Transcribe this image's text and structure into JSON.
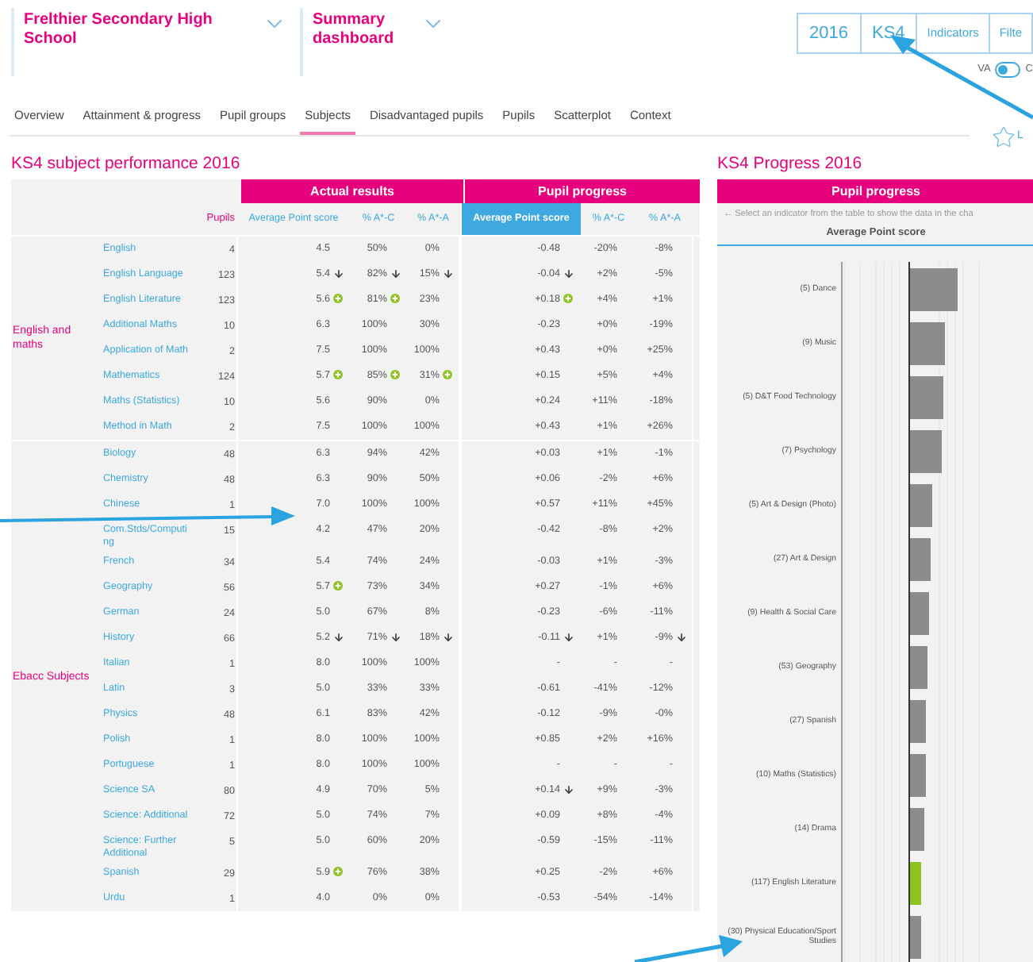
{
  "header": {
    "school": "Frelthier Secondary High School",
    "view": "Summary dashboard"
  },
  "top_buttons": [
    {
      "label": "2016",
      "kind": "value"
    },
    {
      "label": "KS4",
      "kind": "value"
    },
    {
      "label": "Indicators",
      "kind": "menu"
    },
    {
      "label": "Filte",
      "kind": "menu"
    }
  ],
  "toggle": {
    "left_label": "VA",
    "right_label": "C",
    "on": false
  },
  "tabs": [
    {
      "label": "Overview",
      "selected": false
    },
    {
      "label": "Attainment & progress",
      "selected": false
    },
    {
      "label": "Pupil groups",
      "selected": false
    },
    {
      "label": "Subjects",
      "selected": true
    },
    {
      "label": "Disadvantaged pupils",
      "selected": false
    },
    {
      "label": "Pupils",
      "selected": false
    },
    {
      "label": "Scatterplot",
      "selected": false
    },
    {
      "label": "Context",
      "selected": false
    }
  ],
  "favourite": {
    "label": "L"
  },
  "left_title": "KS4 subject performance 2016",
  "table": {
    "group_headers": [
      "Actual results",
      "Pupil progress"
    ],
    "pupils_label": "Pupils",
    "columns": [
      {
        "label": "Average Point score",
        "selected": false
      },
      {
        "label": "% A*-C",
        "selected": false
      },
      {
        "label": "% A*-A",
        "selected": false
      },
      {
        "label": "Average Point score",
        "selected": true
      },
      {
        "label": "% A*-C",
        "selected": false
      },
      {
        "label": "% A*-A",
        "selected": false
      }
    ],
    "groups": [
      {
        "label": "English and maths",
        "rows": [
          {
            "subject": "English",
            "pupils": "4",
            "cells": [
              {
                "text": "4.5"
              },
              {
                "text": "50%"
              },
              {
                "text": "0%"
              },
              {
                "text": "-0.48"
              },
              {
                "text": "-20%"
              },
              {
                "text": "-8%"
              }
            ]
          },
          {
            "subject": "English Language",
            "pupils": "123",
            "cells": [
              {
                "text": "5.4",
                "falling": true
              },
              {
                "text": "82%",
                "falling": true
              },
              {
                "text": "15%",
                "falling": true
              },
              {
                "text": "-0.04",
                "falling": true
              },
              {
                "text": "+2%"
              },
              {
                "text": "-5%"
              }
            ]
          },
          {
            "subject": "English Literature",
            "pupils": "123",
            "cells": [
              {
                "text": "5.6",
                "significant": true
              },
              {
                "text": "81%",
                "significant": true
              },
              {
                "text": "23%"
              },
              {
                "text": "+0.18",
                "significant": true
              },
              {
                "text": "+4%"
              },
              {
                "text": "+1%"
              }
            ]
          },
          {
            "subject": "Additional Maths",
            "pupils": "10",
            "cells": [
              {
                "text": "6.3"
              },
              {
                "text": "100%"
              },
              {
                "text": "30%"
              },
              {
                "text": "-0.23"
              },
              {
                "text": "+0%"
              },
              {
                "text": "-19%"
              }
            ]
          },
          {
            "subject": "Application of Math",
            "pupils": "2",
            "cells": [
              {
                "text": "7.5"
              },
              {
                "text": "100%"
              },
              {
                "text": "100%"
              },
              {
                "text": "+0.43"
              },
              {
                "text": "+0%"
              },
              {
                "text": "+25%"
              }
            ]
          },
          {
            "subject": "Mathematics",
            "pupils": "124",
            "cells": [
              {
                "text": "5.7",
                "significant": true
              },
              {
                "text": "85%",
                "significant": true
              },
              {
                "text": "31%",
                "significant": true
              },
              {
                "text": "+0.15"
              },
              {
                "text": "+5%"
              },
              {
                "text": "+4%"
              }
            ]
          },
          {
            "subject": "Maths (Statistics)",
            "pupils": "10",
            "cells": [
              {
                "text": "5.6"
              },
              {
                "text": "90%"
              },
              {
                "text": "0%"
              },
              {
                "text": "+0.24"
              },
              {
                "text": "+11%"
              },
              {
                "text": "-18%"
              }
            ]
          },
          {
            "subject": "Method in Math",
            "pupils": "2",
            "cells": [
              {
                "text": "7.5"
              },
              {
                "text": "100%"
              },
              {
                "text": "100%"
              },
              {
                "text": "+0.43"
              },
              {
                "text": "+1%"
              },
              {
                "text": "+26%"
              }
            ]
          }
        ]
      },
      {
        "label": "Ebacc Subjects",
        "rows": [
          {
            "subject": "Biology",
            "pupils": "48",
            "cells": [
              {
                "text": "6.3"
              },
              {
                "text": "94%"
              },
              {
                "text": "42%"
              },
              {
                "text": "+0.03"
              },
              {
                "text": "+1%"
              },
              {
                "text": "-1%"
              }
            ]
          },
          {
            "subject": "Chemistry",
            "pupils": "48",
            "cells": [
              {
                "text": "6.3"
              },
              {
                "text": "90%"
              },
              {
                "text": "50%"
              },
              {
                "text": "+0.06"
              },
              {
                "text": "-2%"
              },
              {
                "text": "+6%"
              }
            ]
          },
          {
            "subject": "Chinese",
            "pupils": "1",
            "cells": [
              {
                "text": "7.0"
              },
              {
                "text": "100%"
              },
              {
                "text": "100%"
              },
              {
                "text": "+0.57"
              },
              {
                "text": "+11%"
              },
              {
                "text": "+45%"
              }
            ]
          },
          {
            "subject": "Com.Stds/Computing",
            "pupils": "15",
            "cells": [
              {
                "text": "4.2"
              },
              {
                "text": "47%"
              },
              {
                "text": "20%"
              },
              {
                "text": "-0.42"
              },
              {
                "text": "-8%"
              },
              {
                "text": "+2%"
              }
            ]
          },
          {
            "subject": "French",
            "pupils": "34",
            "cells": [
              {
                "text": "5.4"
              },
              {
                "text": "74%"
              },
              {
                "text": "24%"
              },
              {
                "text": "-0.03"
              },
              {
                "text": "+1%"
              },
              {
                "text": "-3%"
              }
            ]
          },
          {
            "subject": "Geography",
            "pupils": "56",
            "cells": [
              {
                "text": "5.7",
                "significant": true
              },
              {
                "text": "73%"
              },
              {
                "text": "34%"
              },
              {
                "text": "+0.27"
              },
              {
                "text": "-1%"
              },
              {
                "text": "+6%"
              }
            ]
          },
          {
            "subject": "German",
            "pupils": "24",
            "cells": [
              {
                "text": "5.0"
              },
              {
                "text": "67%"
              },
              {
                "text": "8%"
              },
              {
                "text": "-0.23"
              },
              {
                "text": "-6%"
              },
              {
                "text": "-11%"
              }
            ]
          },
          {
            "subject": "History",
            "pupils": "66",
            "cells": [
              {
                "text": "5.2",
                "falling": true
              },
              {
                "text": "71%",
                "falling": true
              },
              {
                "text": "18%",
                "falling": true
              },
              {
                "text": "-0.11",
                "falling": true
              },
              {
                "text": "+1%"
              },
              {
                "text": "-9%",
                "falling": true
              }
            ]
          },
          {
            "subject": "Italian",
            "pupils": "1",
            "cells": [
              {
                "text": "8.0"
              },
              {
                "text": "100%"
              },
              {
                "text": "100%"
              },
              {
                "text": "-"
              },
              {
                "text": "-"
              },
              {
                "text": "-"
              }
            ]
          },
          {
            "subject": "Latin",
            "pupils": "3",
            "cells": [
              {
                "text": "5.0"
              },
              {
                "text": "33%"
              },
              {
                "text": "33%"
              },
              {
                "text": "-0.61"
              },
              {
                "text": "-41%"
              },
              {
                "text": "-12%"
              }
            ]
          },
          {
            "subject": "Physics",
            "pupils": "48",
            "cells": [
              {
                "text": "6.1"
              },
              {
                "text": "83%"
              },
              {
                "text": "42%"
              },
              {
                "text": "-0.12"
              },
              {
                "text": "-9%"
              },
              {
                "text": "-0%"
              }
            ]
          },
          {
            "subject": "Polish",
            "pupils": "1",
            "cells": [
              {
                "text": "8.0"
              },
              {
                "text": "100%"
              },
              {
                "text": "100%"
              },
              {
                "text": "+0.85"
              },
              {
                "text": "+2%"
              },
              {
                "text": "+16%"
              }
            ]
          },
          {
            "subject": "Portuguese",
            "pupils": "1",
            "cells": [
              {
                "text": "8.0"
              },
              {
                "text": "100%"
              },
              {
                "text": "100%"
              },
              {
                "text": "-"
              },
              {
                "text": "-"
              },
              {
                "text": "-"
              }
            ]
          },
          {
            "subject": "Science SA",
            "pupils": "80",
            "cells": [
              {
                "text": "4.9"
              },
              {
                "text": "70%"
              },
              {
                "text": "5%"
              },
              {
                "text": "+0.14",
                "falling": true
              },
              {
                "text": "+9%"
              },
              {
                "text": "-3%"
              }
            ]
          },
          {
            "subject": "Science: Additional",
            "pupils": "72",
            "cells": [
              {
                "text": "5.0"
              },
              {
                "text": "74%"
              },
              {
                "text": "7%"
              },
              {
                "text": "+0.09"
              },
              {
                "text": "+8%"
              },
              {
                "text": "-4%"
              }
            ]
          },
          {
            "subject": "Science: Further Additional",
            "pupils": "5",
            "cells": [
              {
                "text": "5.0"
              },
              {
                "text": "60%"
              },
              {
                "text": "20%"
              },
              {
                "text": "-0.59"
              },
              {
                "text": "-15%"
              },
              {
                "text": "-11%"
              }
            ]
          },
          {
            "subject": "Spanish",
            "pupils": "29",
            "cells": [
              {
                "text": "5.9",
                "significant": true
              },
              {
                "text": "76%"
              },
              {
                "text": "38%"
              },
              {
                "text": "+0.25"
              },
              {
                "text": "-2%"
              },
              {
                "text": "+6%"
              }
            ]
          },
          {
            "subject": "Urdu",
            "pupils": "1",
            "cells": [
              {
                "text": "4.0"
              },
              {
                "text": "0%"
              },
              {
                "text": "0%"
              },
              {
                "text": "-0.53"
              },
              {
                "text": "-54%"
              },
              {
                "text": "-14%"
              }
            ]
          }
        ]
      }
    ]
  },
  "right_title": "KS4 Progress 2016",
  "chart_panel": {
    "header": "Pupil progress",
    "hint": "← Select an indicator from the table to show the data in the cha",
    "measure": "Average Point score",
    "bars": [
      {
        "label": "(5) Dance",
        "highlighted": false
      },
      {
        "label": "(9) Music",
        "highlighted": false
      },
      {
        "label": "(5) D&T Food Technology",
        "highlighted": false
      },
      {
        "label": "(7) Psychology",
        "highlighted": false
      },
      {
        "label": "(5) Art & Design (Photo)",
        "highlighted": false
      },
      {
        "label": "(27) Art & Design",
        "highlighted": false
      },
      {
        "label": "(9) Health & Social Care",
        "highlighted": false
      },
      {
        "label": "(53) Geography",
        "highlighted": false
      },
      {
        "label": "(27) Spanish",
        "highlighted": false
      },
      {
        "label": "(10) Maths (Statistics)",
        "highlighted": false
      },
      {
        "label": "(14) Drama",
        "highlighted": false
      },
      {
        "label": "(117) English Literature",
        "highlighted": true
      },
      {
        "label": "(30) Physical Education/Sport Studies",
        "highlighted": false
      }
    ]
  }
}
